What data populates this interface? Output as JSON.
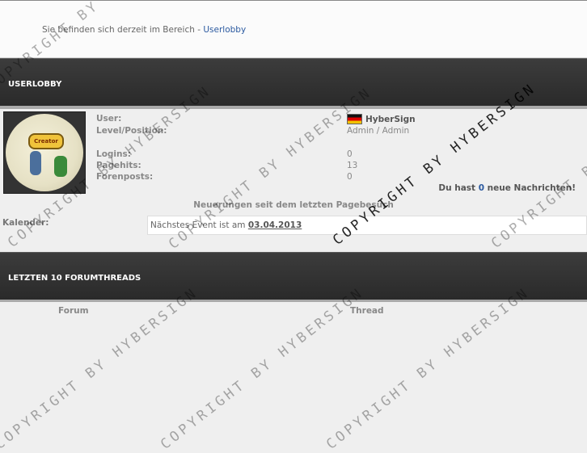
{
  "breadcrumb": {
    "prefix": "Sie befinden sich derzeit im Bereich - ",
    "link": "Userlobby"
  },
  "section1": {
    "title": "USERLOBBY"
  },
  "profile": {
    "labels": {
      "user": "User:",
      "level": "Level/Position:",
      "logins": "Logins:",
      "pagehits": "Pagehits:",
      "forenposts": "Forenposts:"
    },
    "values": {
      "user": "HyberSign",
      "level": "Admin / Admin",
      "logins": "0",
      "pagehits": "13",
      "forenposts": "0"
    },
    "avatar_badge": "Creator",
    "flag_icon": "germany-flag-icon"
  },
  "messages": {
    "prefix": "Du hast ",
    "count": "0",
    "suffix": " neue Nachrichten!"
  },
  "updates_heading": "Neuerungen seit dem letzten Pagebesuch",
  "calendar": {
    "label": "Kalender:",
    "text": "Nächstes Event ist am ",
    "date": "03.04.2013"
  },
  "section2": {
    "title": "LETZTEN 10 FORUMTHREADS"
  },
  "threads_table": {
    "columns": [
      "Forum",
      "Thread"
    ]
  },
  "watermark": {
    "text": "COPYRIGHT BY HYBERSIGN"
  }
}
